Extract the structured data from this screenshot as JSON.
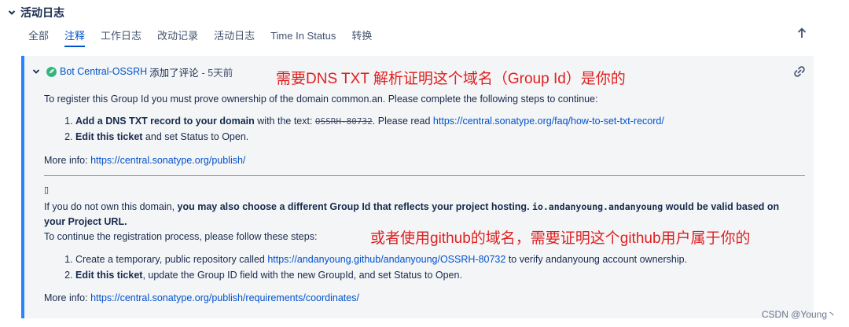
{
  "section": {
    "title": "活动日志"
  },
  "tabs": [
    {
      "label": "全部"
    },
    {
      "label": "注释"
    },
    {
      "label": "工作日志"
    },
    {
      "label": "改动记录"
    },
    {
      "label": "活动日志"
    },
    {
      "label": "Time In Status"
    },
    {
      "label": "转换"
    }
  ],
  "comment": {
    "author": "Bot Central-OSSRH",
    "action": "添加了评论",
    "time": "- 5天前",
    "p1": "To register this Group Id you must prove ownership of the domain common.an. Please complete the following steps to continue:",
    "step1_bold": "Add a DNS TXT record to your domain",
    "step1_mid": " with the text: ",
    "step1_strike": "OSSRH-80732",
    "step1_after": ". Please read ",
    "step1_link": "https://central.sonatype.org/faq/how-to-set-txt-record/",
    "step2_bold": "Edit this ticket",
    "step2_rest": " and set Status to Open.",
    "more1_label": "More info: ",
    "more1_link": "https://central.sonatype.org/publish/",
    "glyph": "▯",
    "p2_a": "If you do not own this domain, ",
    "p2_b": "you may also choose a different Group Id that reflects your project hosting.",
    "p2_code": "io.andanyoung.andanyoung",
    "p2_c": "would be valid based on your Project URL.",
    "p3": "To continue the registration process, please follow these steps:",
    "step3_a": "Create a temporary, public repository called ",
    "step3_link": "https://andanyoung.github/andanyoung/OSSRH-80732",
    "step3_b": " to verify andanyoung account ownership.",
    "step4_bold": "Edit this ticket",
    "step4_rest": ", update the Group ID field with the new GroupId, and set Status to Open.",
    "more2_label": "More info: ",
    "more2_link": "https://central.sonatype.org/publish/requirements/coordinates/"
  },
  "annotations": {
    "a1": "需要DNS TXT 解析证明这个域名（Group Id）是你的",
    "a2": "或者使用github的域名，需要证明这个github用户属于你的"
  },
  "watermark": "CSDN @Young丶",
  "colors": {
    "accent": "#0052cc",
    "card_border": "#2684ff",
    "annotation": "#e02020",
    "avatar": "#36b37e"
  }
}
